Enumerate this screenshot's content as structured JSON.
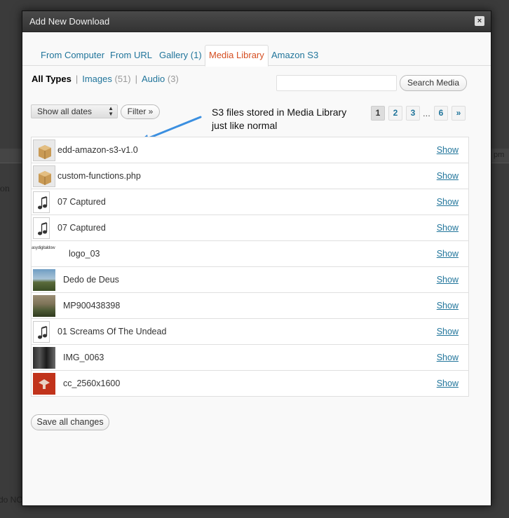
{
  "background": {
    "fragment_1": "pm",
    "fragment_2": "ion",
    "fragment_3": "do NO"
  },
  "dialog": {
    "title": "Add New Download",
    "close_glyph": "×"
  },
  "tabs": [
    {
      "label": "From Computer",
      "active": false
    },
    {
      "label": "From URL",
      "active": false
    },
    {
      "label": "Gallery (1)",
      "active": false
    },
    {
      "label": "Media Library",
      "active": true
    },
    {
      "label": "Amazon S3",
      "active": false
    }
  ],
  "type_filters": {
    "all": "All Types",
    "images_label": "Images",
    "images_count": "(51)",
    "audio_label": "Audio",
    "audio_count": "(3)",
    "separator": "|"
  },
  "search": {
    "value": "",
    "button_label": "Search Media"
  },
  "date_filter": {
    "selected": "Show all dates",
    "filter_button": "Filter »"
  },
  "annotation": {
    "line1": "S3 files stored in Media Library",
    "line2": "just like normal",
    "arrow_color": "#3b8fe0"
  },
  "pagination": {
    "pages": [
      "1",
      "2",
      "3"
    ],
    "ellipsis": "...",
    "last": "6",
    "next": "»",
    "current": "1"
  },
  "media_items": [
    {
      "title": "edd-amazon-s3-v1.0",
      "icon": "package-icon",
      "action": "Show"
    },
    {
      "title": "custom-functions.php",
      "icon": "package-icon",
      "action": "Show"
    },
    {
      "title": "07 Captured",
      "icon": "audio-file-icon",
      "action": "Show"
    },
    {
      "title": "07 Captured",
      "icon": "audio-file-icon",
      "action": "Show"
    },
    {
      "title": "logo_03",
      "icon": "logo-thumbnail",
      "action": "Show",
      "thumb_text": "asydigitaldow"
    },
    {
      "title": "Dedo de Deus",
      "icon": "mountain-thumbnail",
      "action": "Show"
    },
    {
      "title": "MP900438398",
      "icon": "landscape-thumbnail",
      "action": "Show"
    },
    {
      "title": "01 Screams Of The Undead",
      "icon": "audio-file-icon",
      "action": "Show"
    },
    {
      "title": "IMG_0063",
      "icon": "studio-photo-thumbnail",
      "action": "Show"
    },
    {
      "title": "cc_2560x1600",
      "icon": "red-graphic-thumbnail",
      "action": "Show"
    }
  ],
  "footer": {
    "save_label": "Save all changes"
  },
  "colors": {
    "link": "#21759b",
    "active_tab": "#d54e21",
    "titlebar": "#3a3a3a"
  }
}
